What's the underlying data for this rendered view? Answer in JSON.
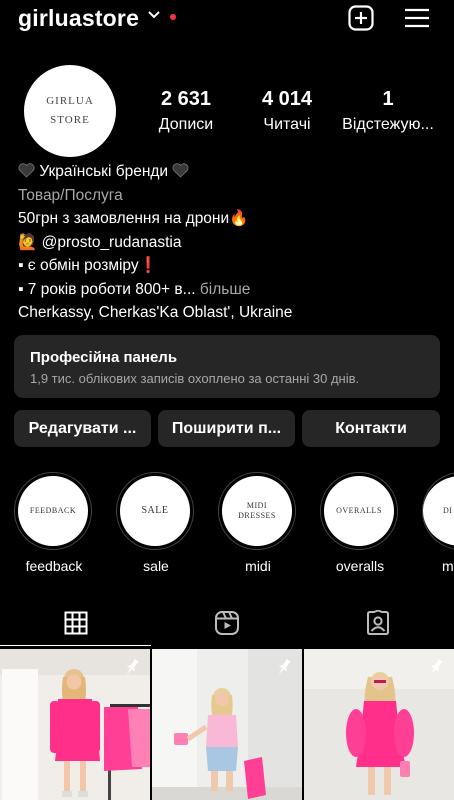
{
  "header": {
    "username": "girluastore",
    "icons": [
      "chevron-down-icon",
      "notification-dot",
      "new-post-icon",
      "menu-icon"
    ],
    "accent_dot_color": "#ff3040"
  },
  "profile": {
    "avatar_line1": "GIRLUA",
    "avatar_line2": "STORE",
    "stats": {
      "posts_value": "2 631",
      "posts_label": "Дописи",
      "followers_value": "4 014",
      "followers_label": "Читачі",
      "following_value": "1",
      "following_label": "Відстежую..."
    }
  },
  "bio": {
    "line1": "Українські бренди",
    "category": "Товар/Послуга",
    "line3": "50грн з замовлення на дрони🔥",
    "mention": "@prosto_rudanastia",
    "line5": "▪ є обмін розміру❗",
    "line6": "▪ 7 років роботи 800+ в...",
    "more": "більше",
    "location": "Cherkassy, Cherkas'Ka Oblast', Ukraine"
  },
  "pro_panel": {
    "title": "Професійна панель",
    "subtitle": "1,9 тис. облікових записів охоплено за останні 30 днів."
  },
  "buttons": {
    "edit": "Редагувати ...",
    "share": "Поширити п...",
    "contacts": "Контакти"
  },
  "highlights": [
    {
      "cover": "FEEDBACK",
      "label": "feedback"
    },
    {
      "cover": "SALE",
      "label": "sale"
    },
    {
      "cover_line1": "MIDI",
      "cover_line2": "DRESSES",
      "label": "midi"
    },
    {
      "cover": "OVERALLS",
      "label": "overalls"
    },
    {
      "cover": "DI",
      "label": "m"
    }
  ],
  "tabs": [
    "grid-icon",
    "reels-icon",
    "tagged-icon"
  ],
  "colors": {
    "background": "#000000",
    "panel": "#262626",
    "secondary_text": "#a8a8a8",
    "dress_pink": "#ff2f8a"
  }
}
